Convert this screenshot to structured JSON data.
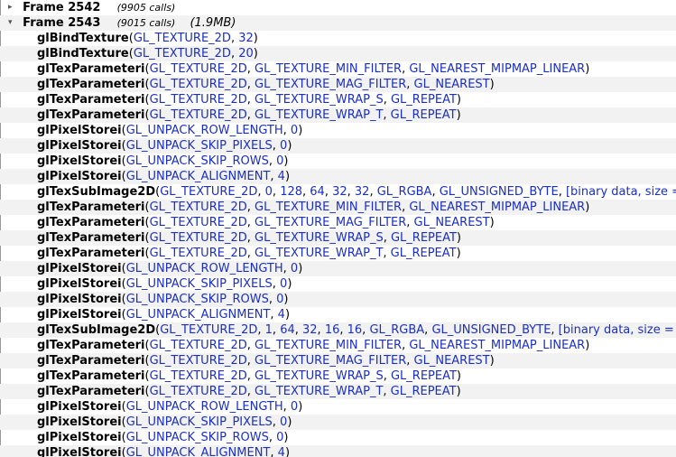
{
  "frames": [
    {
      "name": "Frame 2542",
      "calls": "(9905 calls)",
      "size": "",
      "expanded": false
    },
    {
      "name": "Frame 2543",
      "calls": "(9015 calls)",
      "size": "(1.9MB)",
      "expanded": true
    }
  ],
  "calls": [
    {
      "fn": "glBindTexture",
      "args": [
        "GL_TEXTURE_2D",
        "32"
      ]
    },
    {
      "fn": "glBindTexture",
      "args": [
        "GL_TEXTURE_2D",
        "20"
      ]
    },
    {
      "fn": "glTexParameteri",
      "args": [
        "GL_TEXTURE_2D",
        "GL_TEXTURE_MIN_FILTER",
        "GL_NEAREST_MIPMAP_LINEAR"
      ]
    },
    {
      "fn": "glTexParameteri",
      "args": [
        "GL_TEXTURE_2D",
        "GL_TEXTURE_MAG_FILTER",
        "GL_NEAREST"
      ]
    },
    {
      "fn": "glTexParameteri",
      "args": [
        "GL_TEXTURE_2D",
        "GL_TEXTURE_WRAP_S",
        "GL_REPEAT"
      ]
    },
    {
      "fn": "glTexParameteri",
      "args": [
        "GL_TEXTURE_2D",
        "GL_TEXTURE_WRAP_T",
        "GL_REPEAT"
      ]
    },
    {
      "fn": "glPixelStorei",
      "args": [
        "GL_UNPACK_ROW_LENGTH",
        "0"
      ]
    },
    {
      "fn": "glPixelStorei",
      "args": [
        "GL_UNPACK_SKIP_PIXELS",
        "0"
      ]
    },
    {
      "fn": "glPixelStorei",
      "args": [
        "GL_UNPACK_SKIP_ROWS",
        "0"
      ]
    },
    {
      "fn": "glPixelStorei",
      "args": [
        "GL_UNPACK_ALIGNMENT",
        "4"
      ]
    },
    {
      "fn": "glTexSubImage2D",
      "args": [
        "GL_TEXTURE_2D",
        "0",
        "128",
        "64",
        "32",
        "32",
        "GL_RGBA",
        "GL_UNSIGNED_BYTE",
        "[binary data, size ="
      ]
    },
    {
      "fn": "glTexParameteri",
      "args": [
        "GL_TEXTURE_2D",
        "GL_TEXTURE_MIN_FILTER",
        "GL_NEAREST_MIPMAP_LINEAR"
      ]
    },
    {
      "fn": "glTexParameteri",
      "args": [
        "GL_TEXTURE_2D",
        "GL_TEXTURE_MAG_FILTER",
        "GL_NEAREST"
      ]
    },
    {
      "fn": "glTexParameteri",
      "args": [
        "GL_TEXTURE_2D",
        "GL_TEXTURE_WRAP_S",
        "GL_REPEAT"
      ]
    },
    {
      "fn": "glTexParameteri",
      "args": [
        "GL_TEXTURE_2D",
        "GL_TEXTURE_WRAP_T",
        "GL_REPEAT"
      ]
    },
    {
      "fn": "glPixelStorei",
      "args": [
        "GL_UNPACK_ROW_LENGTH",
        "0"
      ]
    },
    {
      "fn": "glPixelStorei",
      "args": [
        "GL_UNPACK_SKIP_PIXELS",
        "0"
      ]
    },
    {
      "fn": "glPixelStorei",
      "args": [
        "GL_UNPACK_SKIP_ROWS",
        "0"
      ]
    },
    {
      "fn": "glPixelStorei",
      "args": [
        "GL_UNPACK_ALIGNMENT",
        "4"
      ]
    },
    {
      "fn": "glTexSubImage2D",
      "args": [
        "GL_TEXTURE_2D",
        "1",
        "64",
        "32",
        "16",
        "16",
        "GL_RGBA",
        "GL_UNSIGNED_BYTE",
        "[binary data, size ="
      ]
    },
    {
      "fn": "glTexParameteri",
      "args": [
        "GL_TEXTURE_2D",
        "GL_TEXTURE_MIN_FILTER",
        "GL_NEAREST_MIPMAP_LINEAR"
      ]
    },
    {
      "fn": "glTexParameteri",
      "args": [
        "GL_TEXTURE_2D",
        "GL_TEXTURE_MAG_FILTER",
        "GL_NEAREST"
      ]
    },
    {
      "fn": "glTexParameteri",
      "args": [
        "GL_TEXTURE_2D",
        "GL_TEXTURE_WRAP_S",
        "GL_REPEAT"
      ]
    },
    {
      "fn": "glTexParameteri",
      "args": [
        "GL_TEXTURE_2D",
        "GL_TEXTURE_WRAP_T",
        "GL_REPEAT"
      ]
    },
    {
      "fn": "glPixelStorei",
      "args": [
        "GL_UNPACK_ROW_LENGTH",
        "0"
      ]
    },
    {
      "fn": "glPixelStorei",
      "args": [
        "GL_UNPACK_SKIP_PIXELS",
        "0"
      ]
    },
    {
      "fn": "glPixelStorei",
      "args": [
        "GL_UNPACK_SKIP_ROWS",
        "0"
      ]
    },
    {
      "fn": "glPixelStorei",
      "args": [
        "GL_UNPACK_ALIGNMENT",
        "4"
      ]
    }
  ],
  "icons": {
    "collapsed": "triangle-right-icon",
    "expanded": "triangle-down-icon"
  },
  "colors": {
    "argument": "#1a2ec8",
    "alt_row": "#f2f2f2"
  }
}
